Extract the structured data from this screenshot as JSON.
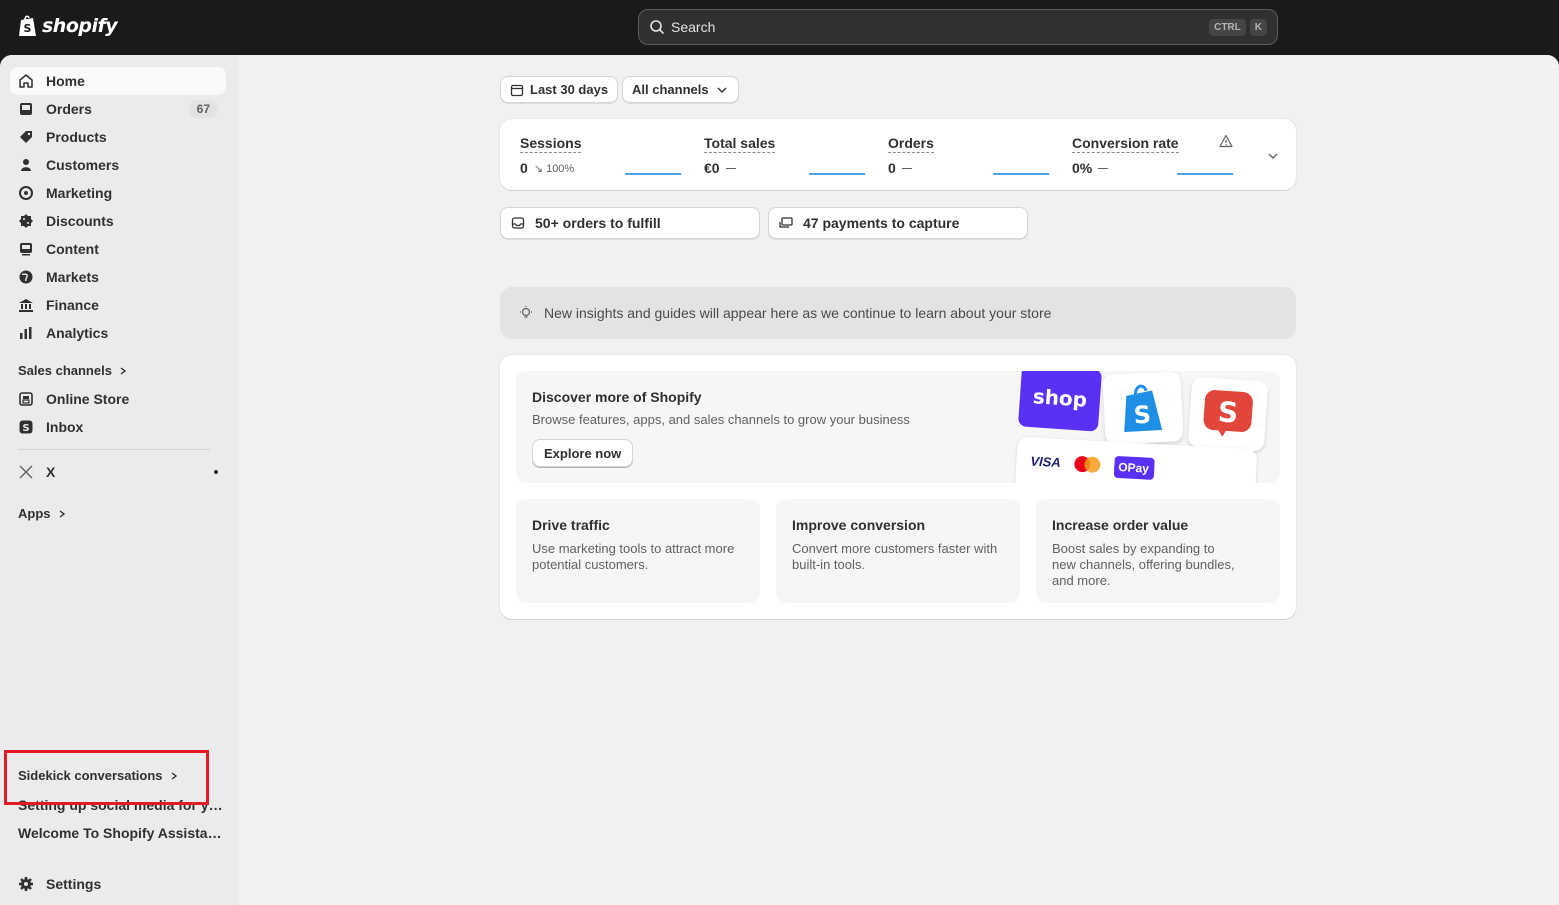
{
  "topbar": {
    "brand": "shopify",
    "search_placeholder": "Search",
    "shortcut_key1": "CTRL",
    "shortcut_key2": "K"
  },
  "sidebar": {
    "items": [
      {
        "label": "Home",
        "icon": "home-icon"
      },
      {
        "label": "Orders",
        "icon": "inbox-icon",
        "badge": "67"
      },
      {
        "label": "Products",
        "icon": "tag-icon"
      },
      {
        "label": "Customers",
        "icon": "person-icon"
      },
      {
        "label": "Marketing",
        "icon": "target-icon"
      },
      {
        "label": "Discounts",
        "icon": "discount-icon"
      },
      {
        "label": "Content",
        "icon": "image-icon"
      },
      {
        "label": "Markets",
        "icon": "globe-icon"
      },
      {
        "label": "Finance",
        "icon": "bank-icon"
      },
      {
        "label": "Analytics",
        "icon": "bar-chart-icon"
      }
    ],
    "sales_channels_title": "Sales channels",
    "channels": [
      {
        "label": "Online Store",
        "icon": "store-icon"
      },
      {
        "label": "Inbox",
        "icon": "shopify-inbox-icon"
      }
    ],
    "x_label": "X",
    "apps_title": "Apps",
    "sidekick_title": "Sidekick conversations",
    "sidekick_items": [
      "Setting up social media for you...",
      "Welcome To Shopify Assistance"
    ],
    "settings_label": "Settings"
  },
  "main": {
    "date_filter": "Last 30 days",
    "channel_filter": "All channels",
    "metrics": [
      {
        "title": "Sessions",
        "value": "0",
        "change": "↘ 100%"
      },
      {
        "title": "Total sales",
        "value": "€0",
        "change": ""
      },
      {
        "title": "Orders",
        "value": "0",
        "change": ""
      },
      {
        "title": "Conversion rate",
        "value": "0%",
        "change": ""
      }
    ],
    "actions": [
      "50+ orders to fulfill",
      "47 payments to capture"
    ],
    "insight_text": "New insights and guides will appear here as we continue to learn about your store",
    "discover": {
      "title": "Discover more of Shopify",
      "subtitle": "Browse features, apps, and sales channels to grow your business",
      "button": "Explore now",
      "shop_logo_text": "shop",
      "card_brand": "VISA",
      "card_brand2": "OPay"
    },
    "tiles": [
      {
        "title": "Drive traffic",
        "desc": "Use marketing tools to attract more potential customers."
      },
      {
        "title": "Improve conversion",
        "desc": "Convert more customers faster with built-in tools."
      },
      {
        "title": "Increase order value",
        "desc": "Boost sales by expanding to new channels, offering bundles, and more."
      }
    ]
  }
}
